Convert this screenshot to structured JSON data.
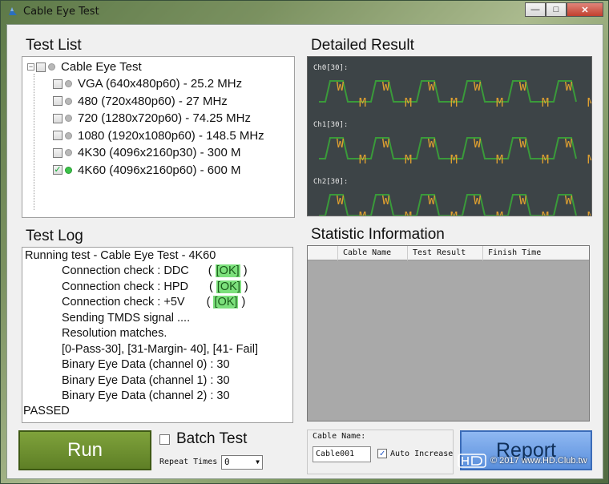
{
  "window": {
    "title": "Cable Eye Test",
    "buttons": {
      "minimize": "—",
      "maximize": "□",
      "close": "✕"
    }
  },
  "test_list": {
    "heading": "Test List",
    "root": {
      "label": "Cable Eye Test",
      "expander": "−"
    },
    "items": [
      {
        "label": "VGA (640x480p60) - 25.2 MHz",
        "checked": false,
        "status": "idle"
      },
      {
        "label": "480 (720x480p60) - 27 MHz",
        "checked": false,
        "status": "idle"
      },
      {
        "label": "720 (1280x720p60) - 74.25 MHz",
        "checked": false,
        "status": "idle"
      },
      {
        "label": "1080 (1920x1080p60) - 148.5 MHz",
        "checked": false,
        "status": "idle"
      },
      {
        "label": "4K30 (4096x2160p30) - 300 M",
        "checked": false,
        "status": "idle"
      },
      {
        "label": "4K60 (4096x2160p60) - 600 M",
        "checked": true,
        "status": "active"
      }
    ]
  },
  "detailed_result": {
    "heading": "Detailed Result",
    "channels": [
      "Ch0[30]:",
      "Ch1[30]:",
      "Ch2[30]:"
    ],
    "colors": {
      "background": "#3d4447",
      "trace_green": "#3a9a3a",
      "trace_orange": "#e0a030"
    },
    "glyph_up": "W",
    "glyph_down": "M"
  },
  "test_log": {
    "heading": "Test Log",
    "lines": [
      "Running test - Cable Eye Test - 4K60",
      "Connection check : DDC",
      "Connection check : HPD",
      "Connection check : +5V",
      "Sending TMDS signal ....",
      "Resolution matches.",
      "[0-Pass-30], [31-Margin- 40], [41- Fail]",
      "Binary Eye Data (channel 0) : 30",
      "Binary Eye Data (channel 1) : 30",
      "Binary Eye Data (channel 2) : 30",
      "PASSED"
    ],
    "ok_open": "(",
    "ok_text": "[OK]",
    "ok_close": ")"
  },
  "statistic": {
    "heading": "Statistic Information",
    "columns": [
      "",
      "Cable Name",
      "Test Result",
      "Finish Time"
    ]
  },
  "controls": {
    "run_label": "Run",
    "batch_label": "Batch Test",
    "repeat_label": "Repeat Times",
    "repeat_value": "0",
    "cable_name_label": "Cable Name:",
    "cable_name_value": "Cable001",
    "auto_increase_label": "Auto Increase",
    "auto_increase_checked": true,
    "report_label": "Report"
  },
  "watermark": {
    "text": "© 2017 www.HD.Club.tw"
  }
}
